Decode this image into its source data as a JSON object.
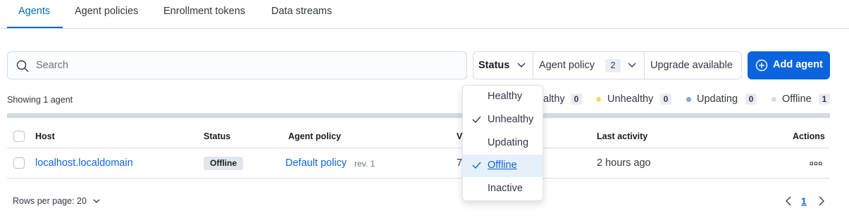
{
  "tabs": [
    {
      "label": "Agents",
      "active": true
    },
    {
      "label": "Agent policies"
    },
    {
      "label": "Enrollment tokens"
    },
    {
      "label": "Data streams"
    }
  ],
  "search": {
    "placeholder": "Search",
    "value": ""
  },
  "filters": {
    "status_label": "Status",
    "agent_policy_label": "Agent policy",
    "agent_policy_count": "2",
    "upgrade_label": "Upgrade available"
  },
  "add_agent_label": "Add agent",
  "showing_text": "Showing 1 agent",
  "status_summary": [
    {
      "label": "Healthy",
      "visible_text": "althy",
      "count": "0",
      "color": "#54b399"
    },
    {
      "label": "Unhealthy",
      "count": "0",
      "color": "#f1d86f"
    },
    {
      "label": "Updating",
      "count": "0",
      "color": "#79aad9"
    },
    {
      "label": "Offline",
      "count": "1",
      "color": "#d3dae6"
    }
  ],
  "table": {
    "columns": [
      "Host",
      "Status",
      "Agent policy",
      "V",
      "Last activity",
      "Actions"
    ],
    "rows": [
      {
        "host": "localhost.localdomain",
        "status": "Offline",
        "policy": "Default policy",
        "revision": "rev. 1",
        "version_partial": "7",
        "last_activity": "2 hours ago"
      }
    ]
  },
  "footer": {
    "rows_per_page": "Rows per page: 20",
    "current_page": "1"
  },
  "status_dropdown": {
    "options": [
      {
        "label": "Healthy",
        "checked": false
      },
      {
        "label": "Unhealthy",
        "checked": true
      },
      {
        "label": "Updating",
        "checked": false
      },
      {
        "label": "Offline",
        "checked": true,
        "highlighted": true
      },
      {
        "label": "Inactive",
        "checked": false
      }
    ]
  },
  "colors": {
    "accent": "#0b64dd",
    "tab_active": "#006bb8",
    "border": "#d3dae6"
  }
}
